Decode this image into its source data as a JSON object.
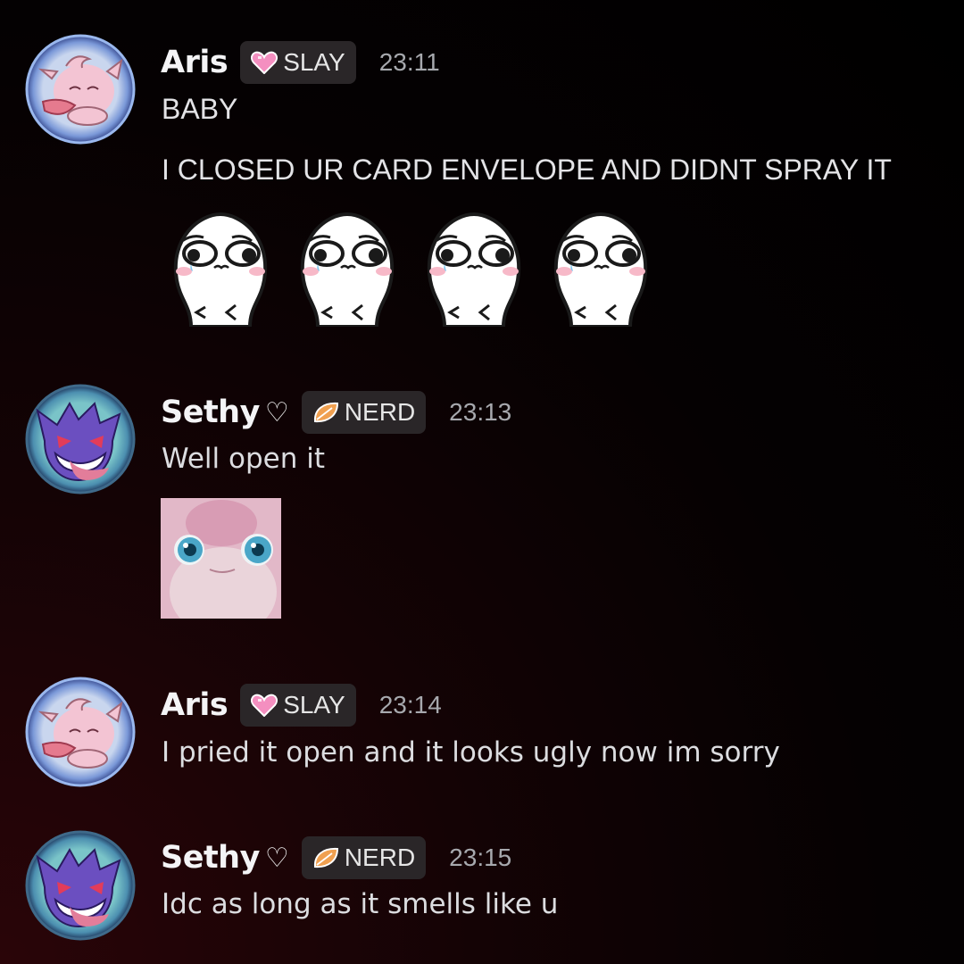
{
  "messages": [
    {
      "author": "Aris",
      "avatar": "clefairy-avatar",
      "role_tag": {
        "icon": "pink-heart-icon",
        "label": "SLAY"
      },
      "time": "23:11",
      "lines": [
        "BABY",
        "I CLOSED UR CARD ENVELOPE AND DIDNT SPRAY IT"
      ],
      "stickers": [
        "crying-blob-emoji",
        "crying-blob-emoji",
        "crying-blob-emoji",
        "crying-blob-emoji"
      ]
    },
    {
      "author": "Sethy",
      "author_suffix": "♡",
      "avatar": "gengar-avatar",
      "role_tag": {
        "icon": "leaf-icon",
        "label": "NERD"
      },
      "time": "23:13",
      "lines": [
        "Well open it"
      ],
      "attachment": "wigglytuff-image"
    },
    {
      "author": "Aris",
      "avatar": "clefairy-avatar",
      "role_tag": {
        "icon": "pink-heart-icon",
        "label": "SLAY"
      },
      "time": "23:14",
      "lines": [
        "I pried  it open and it looks ugly now im sorry"
      ]
    },
    {
      "author": "Sethy",
      "author_suffix": "♡",
      "avatar": "gengar-avatar",
      "role_tag": {
        "icon": "leaf-icon",
        "label": "NERD"
      },
      "time": "23:15",
      "lines": [
        "Idc as long as it smells like u"
      ]
    }
  ],
  "colors": {
    "tag_background": "#2a2628",
    "timestamp": "#a7a9ae",
    "heart": "#f48fc0",
    "leaf": "#f0a050"
  }
}
